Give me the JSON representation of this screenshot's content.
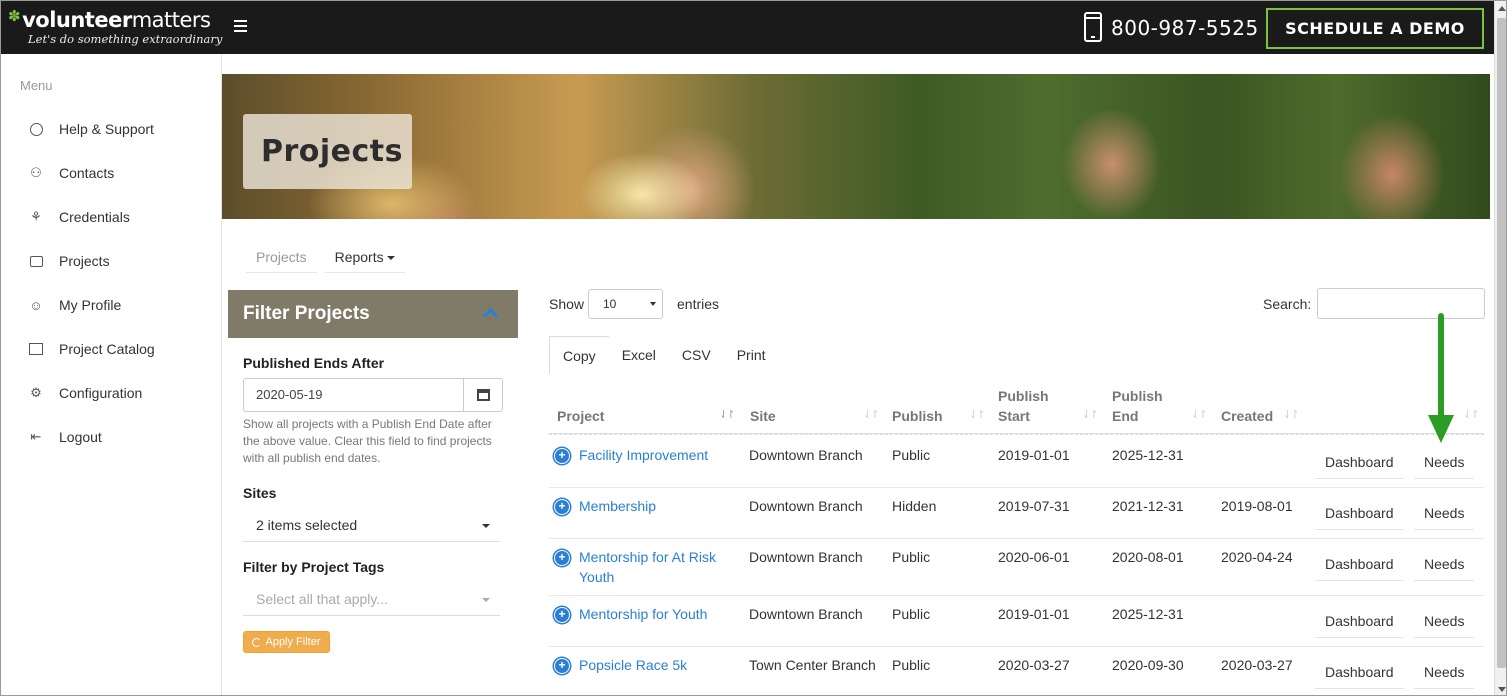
{
  "header": {
    "logo_bold": "volunteer",
    "logo_thin": "matters",
    "tagline": "Let's do something extraordinary",
    "phone": "800-987-5525",
    "demo_button": "SCHEDULE A DEMO"
  },
  "sidebar": {
    "menu_title": "Menu",
    "items": [
      {
        "label": "Help & Support",
        "icon": "life-ring-icon"
      },
      {
        "label": "Contacts",
        "icon": "contacts-icon"
      },
      {
        "label": "Credentials",
        "icon": "award-icon"
      },
      {
        "label": "Projects",
        "icon": "briefcase-icon"
      },
      {
        "label": "My Profile",
        "icon": "smiley-icon"
      },
      {
        "label": "Project Catalog",
        "icon": "book-icon"
      },
      {
        "label": "Configuration",
        "icon": "gear-icon"
      },
      {
        "label": "Logout",
        "icon": "logout-icon"
      }
    ]
  },
  "hero": {
    "title": "Projects"
  },
  "subnav": {
    "projects": "Projects",
    "reports": "Reports"
  },
  "filter": {
    "title": "Filter Projects",
    "published_ends_label": "Published Ends After",
    "published_ends_value": "2020-05-19",
    "published_help": "Show all projects with a Publish End Date after the above value. Clear this field to find projects with all publish end dates.",
    "sites_label": "Sites",
    "sites_value": "2 items selected",
    "tags_label": "Filter by Project Tags",
    "tags_placeholder": "Select all that apply...",
    "apply_button": "Apply Filter"
  },
  "table_controls": {
    "show_label": "Show",
    "length_value": "10",
    "entries_label": "entries",
    "search_label": "Search:",
    "exports": [
      "Copy",
      "Excel",
      "CSV",
      "Print"
    ]
  },
  "table": {
    "headers": {
      "project": "Project",
      "site": "Site",
      "publish": "Publish",
      "publish_start_1": "Publish",
      "publish_start_2": "Start",
      "publish_end_1": "Publish",
      "publish_end_2": "End",
      "created": "Created"
    },
    "action_labels": {
      "dashboard": "Dashboard",
      "needs": "Needs"
    },
    "rows": [
      {
        "project": "Facility Improvement",
        "project_line2": "",
        "site": "Downtown Branch",
        "publish": "Public",
        "start": "2019-01-01",
        "end": "2025-12-31",
        "created": ""
      },
      {
        "project": "Membership",
        "project_line2": "",
        "site": "Downtown Branch",
        "publish": "Hidden",
        "start": "2019-07-31",
        "end": "2021-12-31",
        "created": "2019-08-01"
      },
      {
        "project": "Mentorship for At Risk",
        "project_line2": "Youth",
        "site": "Downtown Branch",
        "publish": "Public",
        "start": "2020-06-01",
        "end": "2020-08-01",
        "created": "2020-04-24"
      },
      {
        "project": "Mentorship for Youth",
        "project_line2": "",
        "site": "Downtown Branch",
        "publish": "Public",
        "start": "2019-01-01",
        "end": "2025-12-31",
        "created": ""
      },
      {
        "project": "Popsicle Race 5k",
        "project_line2": "",
        "site": "Town Center Branch",
        "publish": "Public",
        "start": "2020-03-27",
        "end": "2020-09-30",
        "created": "2020-03-27"
      }
    ]
  },
  "colors": {
    "topbar": "#1a1a1a",
    "accent_green": "#7bc142",
    "link_blue": "#2a7fd5",
    "filter_header": "#7f7b68",
    "apply_orange": "#f0ad4e",
    "annotation_arrow": "#2a9d22"
  }
}
